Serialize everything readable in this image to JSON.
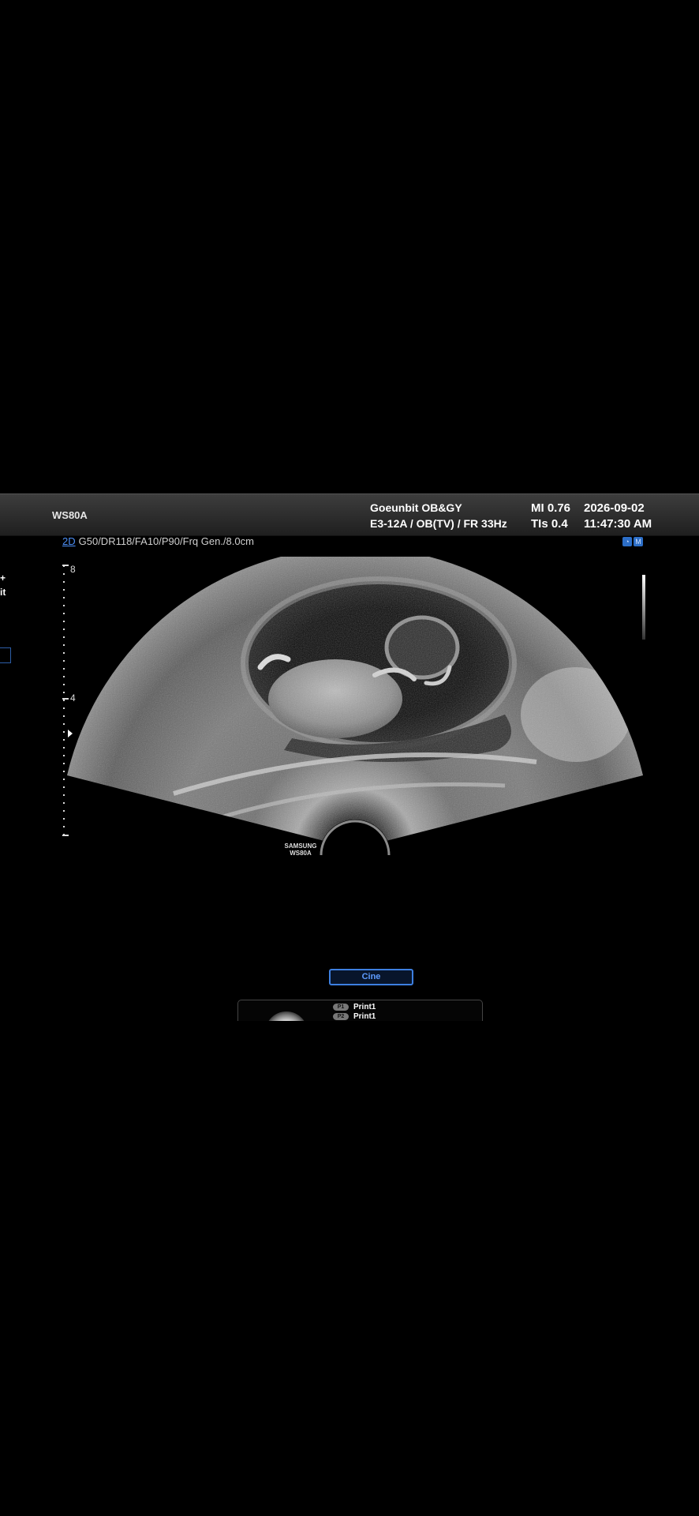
{
  "header": {
    "device": "WS80A",
    "hospital": "Goeunbit OB&GY",
    "probe_info": "E3-12A / OB(TV) / FR 33Hz",
    "mi": "MI  0.76",
    "tis": "TIs 0.4",
    "date": "2026-09-02",
    "time": "11:47:30 AM"
  },
  "params": {
    "mode": "2D",
    "values": "G50/DR118/FA10/P90/Frq Gen./8.0cm"
  },
  "mode_icons": [
    "◔",
    "M"
  ],
  "depth": {
    "label_top": "8",
    "label_mid": "4"
  },
  "left_clip": {
    "line1": "+",
    "line2": "it"
  },
  "probe_brand": {
    "line1": "SAMSUNG",
    "line2": "WS80A"
  },
  "cine_label": "Cine",
  "print": {
    "p1_key": "P1",
    "p1_label": "Print1",
    "p2_key": "P2",
    "p2_label": "Print1"
  },
  "colors": {
    "accent": "#3d7fe0",
    "header_bg": "#2e2e2e"
  }
}
